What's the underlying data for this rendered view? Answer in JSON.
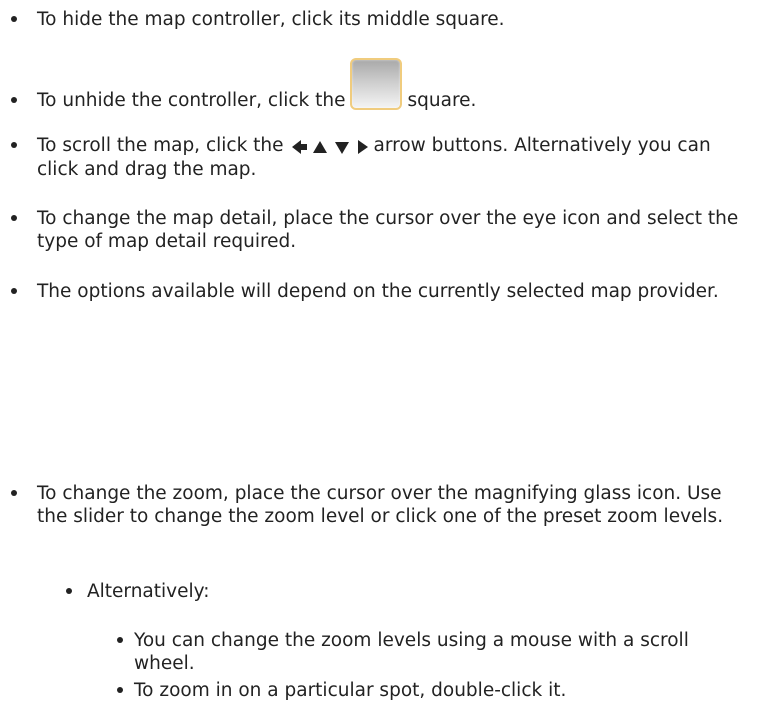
{
  "items": [
    {
      "text": "To hide the map controller, click its middle square."
    },
    {
      "text_before": "To unhide the controller, click the",
      "text_after": "square.",
      "icon": "unhide-square-icon"
    },
    {
      "text_before": "To scroll the map, click the",
      "arrow_icons": [
        "arrow-left-icon",
        "arrow-up-icon",
        "arrow-down-icon",
        "arrow-right-icon"
      ],
      "text_after": "arrow buttons. Alternatively you can click and drag the map."
    },
    {
      "text": "To change the map detail, place the cursor over the eye icon and select the type of map detail required."
    },
    {
      "text": "The options available will depend on the currently selected map provider."
    },
    {
      "text": "To change the zoom, place the cursor over the magnifying glass icon. Use the slider to change the zoom level or click one of the preset zoom levels."
    }
  ],
  "sub_item": {
    "text": "Alternatively:"
  },
  "sub_sub_items": [
    {
      "text": "You can change the zoom levels using a mouse with a scroll wheel."
    },
    {
      "text": "To zoom in on a particular spot, double-click it."
    }
  ],
  "colors": {
    "text": "#222222",
    "square_border": "#f0cc7e"
  }
}
